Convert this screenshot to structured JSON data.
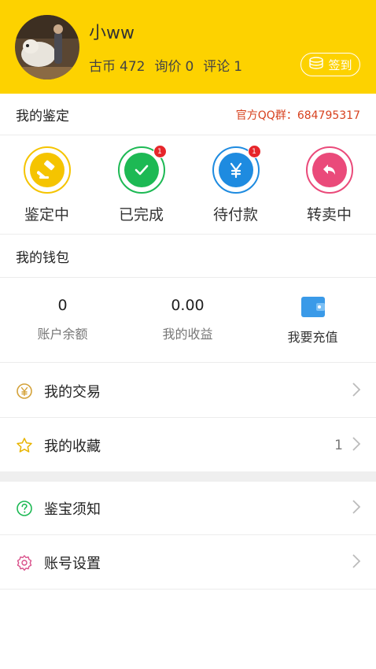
{
  "profile": {
    "username": "小ww",
    "coins_label": "古币",
    "coins": "472",
    "inquiries_label": "询价",
    "inquiries": "0",
    "comments_label": "评论",
    "comments": "1",
    "signin_label": "签到"
  },
  "appraisal": {
    "title": "我的鉴定",
    "qq_group": "官方QQ群：684795317",
    "items": [
      {
        "label": "鉴定中",
        "icon": "hammer-icon",
        "color": "#f5c400",
        "badge": ""
      },
      {
        "label": "已完成",
        "icon": "check-icon",
        "color": "#1db954",
        "badge": "1"
      },
      {
        "label": "待付款",
        "icon": "yen-icon",
        "color": "#1e8be0",
        "badge": "1"
      },
      {
        "label": "转卖中",
        "icon": "return-arrow-icon",
        "color": "#ea4a7a",
        "badge": ""
      }
    ]
  },
  "wallet": {
    "title": "我的钱包",
    "balance_value": "0",
    "balance_label": "账户余额",
    "earnings_value": "0.00",
    "earnings_label": "我的收益",
    "recharge_label": "我要充值"
  },
  "menu": {
    "transactions": "我的交易",
    "favorites": "我的收藏",
    "favorites_count": "1",
    "guide": "鉴宝须知",
    "settings": "账号设置"
  },
  "colors": {
    "header_bg": "#fdd200",
    "qq_text": "#d7421f",
    "badge": "#e6262b"
  }
}
